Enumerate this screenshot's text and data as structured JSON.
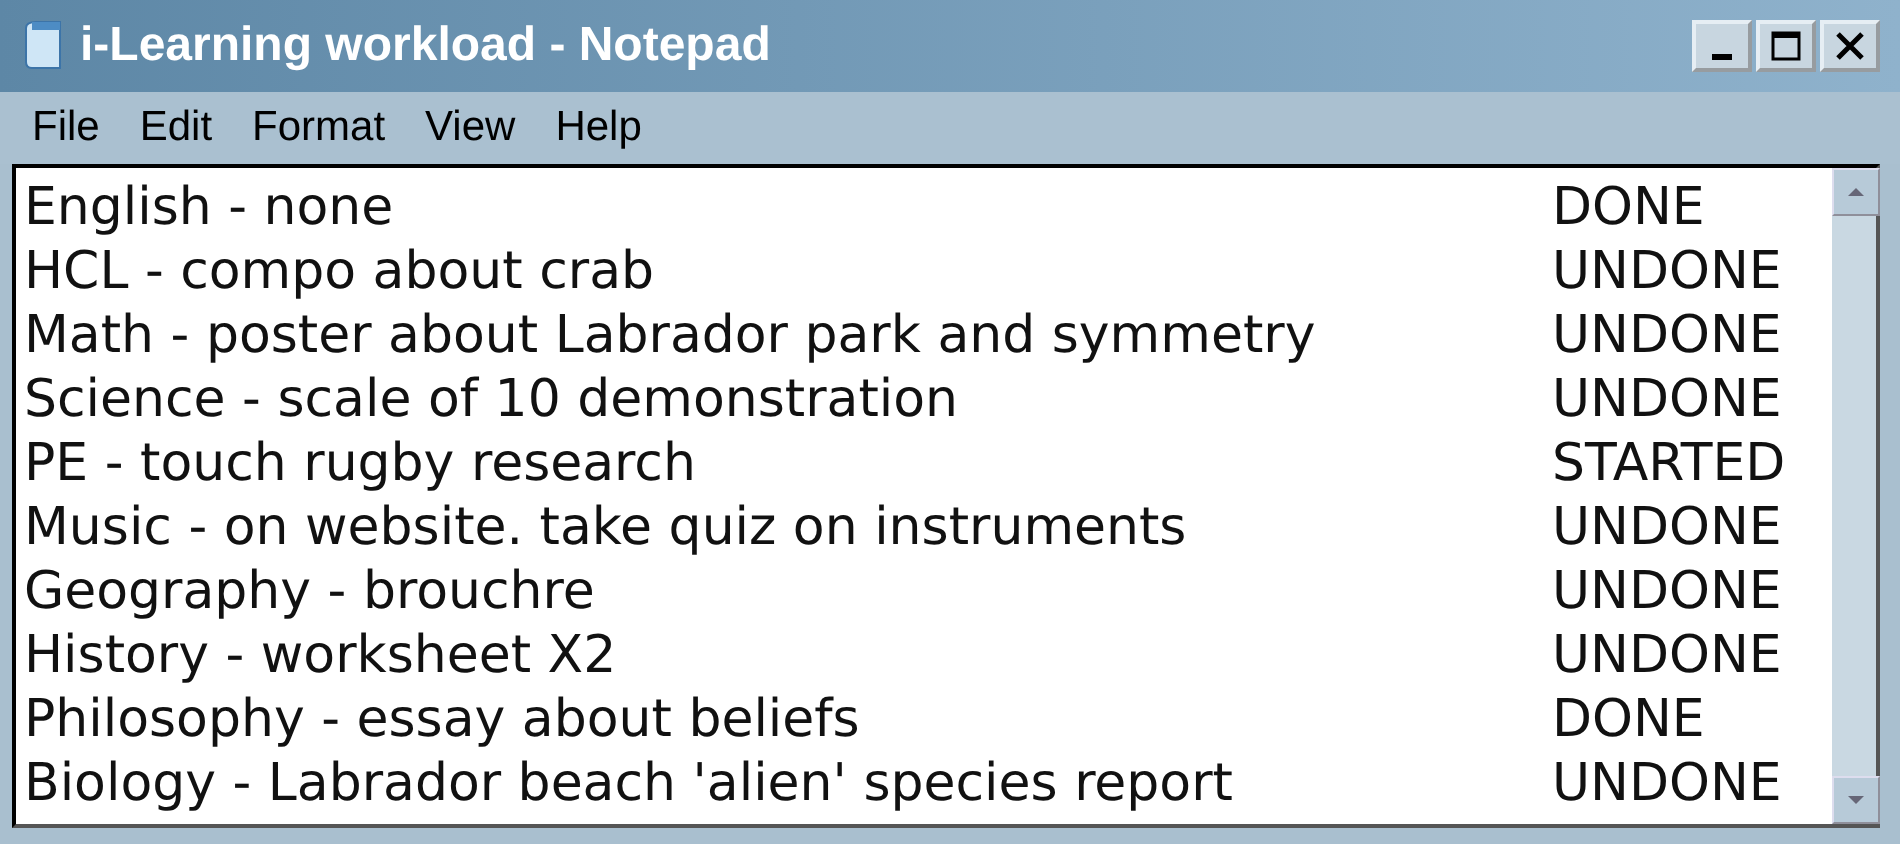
{
  "window": {
    "title": "i-Learning workload - Notepad"
  },
  "menu": [
    "File",
    "Edit",
    "Format",
    "View",
    "Help"
  ],
  "lines": [
    {
      "task": "English - none",
      "status": "DONE"
    },
    {
      "task": "HCL - compo about crab",
      "status": "UNDONE"
    },
    {
      "task": "Math - poster about Labrador park and symmetry",
      "status": "UNDONE"
    },
    {
      "task": "Science - scale of 10 demonstration",
      "status": "UNDONE"
    },
    {
      "task": "PE - touch rugby research",
      "status": "STARTED"
    },
    {
      "task": "Music - on website. take quiz on instruments",
      "status": "UNDONE"
    },
    {
      "task": "Geography - brouchre",
      "status": "UNDONE"
    },
    {
      "task": "History - worksheet X2",
      "status": "UNDONE"
    },
    {
      "task": "Philosophy - essay about beliefs",
      "status": "DONE"
    },
    {
      "task": "Biology - Labrador beach 'alien' species report",
      "status": "UNDONE"
    }
  ]
}
